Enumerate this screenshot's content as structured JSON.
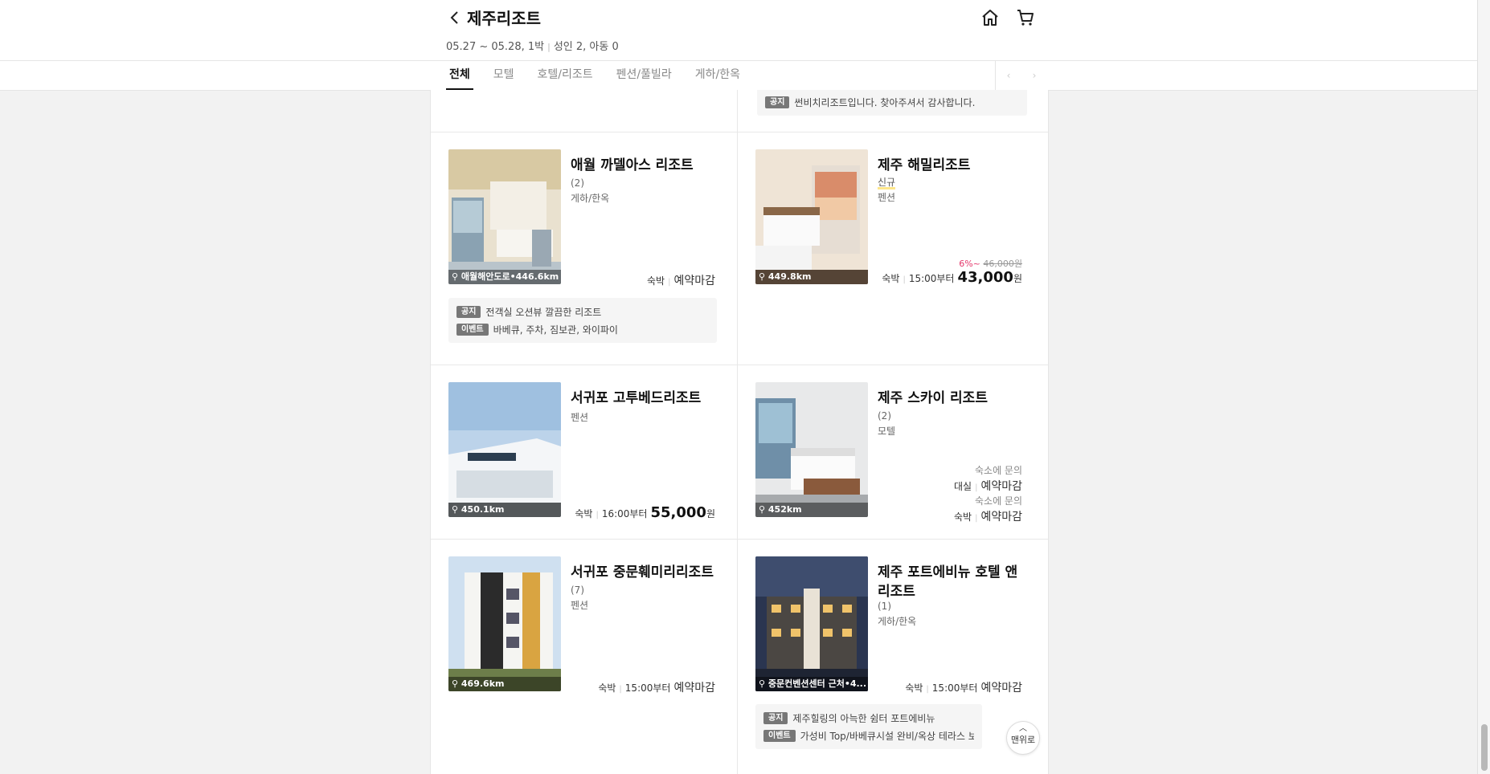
{
  "header": {
    "title": "제주리조트",
    "dates": "05.27 ~ 05.28, 1박",
    "guests": "성인 2, 아동 0"
  },
  "tabs": [
    {
      "label": "전체"
    },
    {
      "label": "모텔"
    },
    {
      "label": "호텔/리조트"
    },
    {
      "label": "펜션/풀빌라"
    },
    {
      "label": "게하/한옥"
    }
  ],
  "top_notice": {
    "badge": "공지",
    "text": "썬비치리조트입니다. 찾아주셔서 감사합니다."
  },
  "listings": [
    {
      "name": "애월 까델아스 리조트",
      "reviews": "(2)",
      "category": "게하/한옥",
      "distance": "애월해안도로•446.6km",
      "stay_label": "숙박",
      "status": "예약마감",
      "notice_badge": "공지",
      "notice_text": "전객실 오션뷰 깔끔한 리조트",
      "event_badge": "이벤트",
      "event_text": "바베큐, 주차, 짐보관, 와이파이"
    },
    {
      "name": "제주 해밀리조트",
      "tag": "신규",
      "category": "펜션",
      "distance": "449.8km",
      "discount": "6%~",
      "original_price": "46,000원",
      "stay_label": "숙박",
      "checkin": "15:00부터",
      "price": "43,000",
      "currency": "원"
    },
    {
      "name": "서귀포 고투베드리조트",
      "category": "펜션",
      "distance": "450.1km",
      "stay_label": "숙박",
      "checkin": "16:00부터",
      "price": "55,000",
      "currency": "원"
    },
    {
      "name": "제주 스카이 리조트",
      "reviews": "(2)",
      "category": "모텔",
      "distance": "452km",
      "inquiry": "숙소에 문의",
      "rent_label": "대실",
      "rent_status": "예약마감",
      "inquiry2": "숙소에 문의",
      "stay_label": "숙박",
      "status": "예약마감"
    },
    {
      "name": "서귀포 중문훼미리리조트",
      "reviews": "(7)",
      "category": "펜션",
      "distance": "469.6km",
      "stay_label": "숙박",
      "checkin": "15:00부터",
      "status": "예약마감"
    },
    {
      "name": "제주 포트에비뉴 호텔 앤 리조트",
      "reviews": "(1)",
      "category": "게하/한옥",
      "distance": "중문컨벤션센터 근처•4...",
      "stay_label": "숙박",
      "checkin": "15:00부터",
      "status": "예약마감",
      "notice_badge": "공지",
      "notice_text": "제주힐링의 아늑한 쉼터 포트에비뉴",
      "event_badge": "이벤트",
      "event_text": "가성비 Top/바베큐시설 완비/옥상 테라스 보유/..."
    }
  ],
  "top_button": {
    "label": "맨위로"
  },
  "colors": {
    "discount": "#e4376b",
    "badge": "#777777",
    "new_underline": "#fde68a"
  }
}
